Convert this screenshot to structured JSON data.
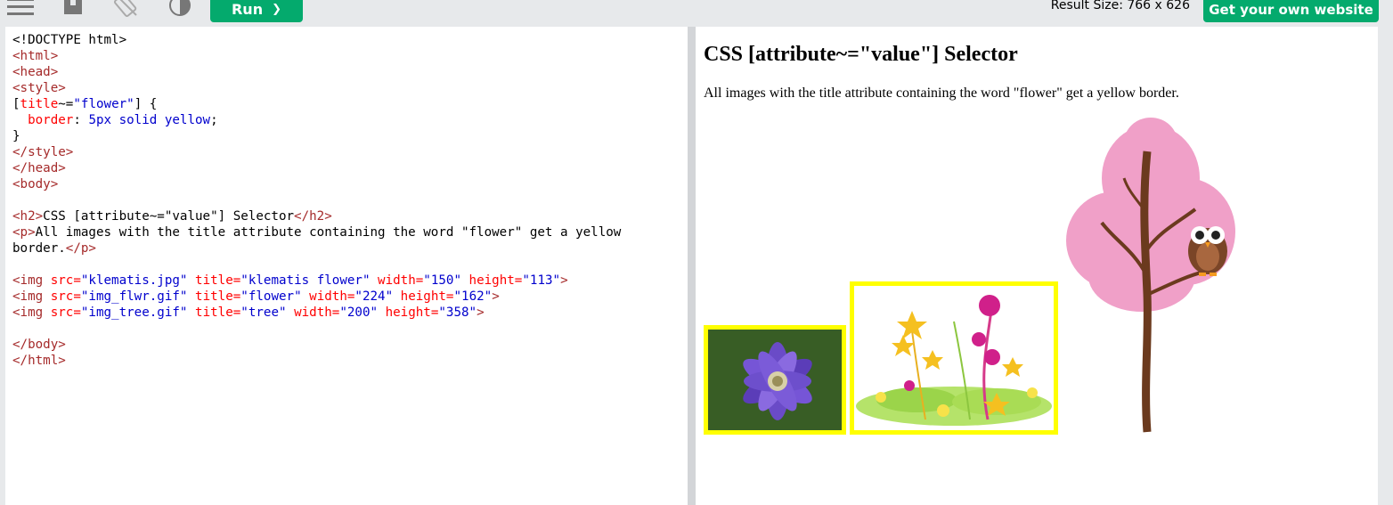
{
  "toolbar": {
    "run_label": "Run",
    "run_arrow": "❯",
    "result_size": "Result Size: 766 x 626",
    "get_website_label": "Get your own website"
  },
  "code": {
    "lines": [
      [
        {
          "c": "p",
          "t": "<!DOCTYPE html>"
        }
      ],
      [
        {
          "c": "t",
          "t": "<html>"
        }
      ],
      [
        {
          "c": "t",
          "t": "<head>"
        }
      ],
      [
        {
          "c": "t",
          "t": "<style>"
        }
      ],
      [
        {
          "c": "p",
          "t": "["
        },
        {
          "c": "a",
          "t": "title"
        },
        {
          "c": "p",
          "t": "~="
        },
        {
          "c": "v",
          "t": "\"flower\""
        },
        {
          "c": "p",
          "t": "] {"
        }
      ],
      [
        {
          "c": "a",
          "t": "  border"
        },
        {
          "c": "p",
          "t": ": "
        },
        {
          "c": "v",
          "t": "5px solid yellow"
        },
        {
          "c": "p",
          "t": ";"
        }
      ],
      [
        {
          "c": "p",
          "t": "}"
        }
      ],
      [
        {
          "c": "t",
          "t": "</style>"
        }
      ],
      [
        {
          "c": "t",
          "t": "</head>"
        }
      ],
      [
        {
          "c": "t",
          "t": "<body>"
        }
      ],
      [
        {
          "c": "p",
          "t": ""
        }
      ],
      [
        {
          "c": "t",
          "t": "<h2>"
        },
        {
          "c": "p",
          "t": "CSS [attribute~=\"value\"] Selector"
        },
        {
          "c": "t",
          "t": "</h2>"
        }
      ],
      [
        {
          "c": "t",
          "t": "<p>"
        },
        {
          "c": "p",
          "t": "All images with the title attribute containing the word \"flower\" get a yellow"
        }
      ],
      [
        {
          "c": "p",
          "t": "border."
        },
        {
          "c": "t",
          "t": "</p>"
        }
      ],
      [
        {
          "c": "p",
          "t": ""
        }
      ],
      [
        {
          "c": "t",
          "t": "<img "
        },
        {
          "c": "a",
          "t": "src="
        },
        {
          "c": "v",
          "t": "\"klematis.jpg\""
        },
        {
          "c": "a",
          "t": " title="
        },
        {
          "c": "v",
          "t": "\"klematis flower\""
        },
        {
          "c": "a",
          "t": " width="
        },
        {
          "c": "v",
          "t": "\"150\""
        },
        {
          "c": "a",
          "t": " height="
        },
        {
          "c": "v",
          "t": "\"113\""
        },
        {
          "c": "t",
          "t": ">"
        }
      ],
      [
        {
          "c": "t",
          "t": "<img "
        },
        {
          "c": "a",
          "t": "src="
        },
        {
          "c": "v",
          "t": "\"img_flwr.gif\""
        },
        {
          "c": "a",
          "t": " title="
        },
        {
          "c": "v",
          "t": "\"flower\""
        },
        {
          "c": "a",
          "t": " width="
        },
        {
          "c": "v",
          "t": "\"224\""
        },
        {
          "c": "a",
          "t": " height="
        },
        {
          "c": "v",
          "t": "\"162\""
        },
        {
          "c": "t",
          "t": ">"
        }
      ],
      [
        {
          "c": "t",
          "t": "<img "
        },
        {
          "c": "a",
          "t": "src="
        },
        {
          "c": "v",
          "t": "\"img_tree.gif\""
        },
        {
          "c": "a",
          "t": " title="
        },
        {
          "c": "v",
          "t": "\"tree\""
        },
        {
          "c": "a",
          "t": " width="
        },
        {
          "c": "v",
          "t": "\"200\""
        },
        {
          "c": "a",
          "t": " height="
        },
        {
          "c": "v",
          "t": "\"358\""
        },
        {
          "c": "t",
          "t": ">"
        }
      ],
      [
        {
          "c": "p",
          "t": ""
        }
      ],
      [
        {
          "c": "t",
          "t": "</body>"
        }
      ],
      [
        {
          "c": "t",
          "t": "</html>"
        }
      ]
    ]
  },
  "result": {
    "heading": "CSS [attribute~=\"value\"] Selector",
    "paragraph": "All images with the title attribute containing the word \"flower\" get a yellow border."
  },
  "icons": [
    "menu-icon",
    "save-icon",
    "rotate-icon",
    "contrast-icon"
  ],
  "colors": {
    "accent": "#04aa6d",
    "tag": "#a52a2a",
    "attr": "#ff0000",
    "value": "#0000cd",
    "border_highlight": "#ffff00"
  }
}
